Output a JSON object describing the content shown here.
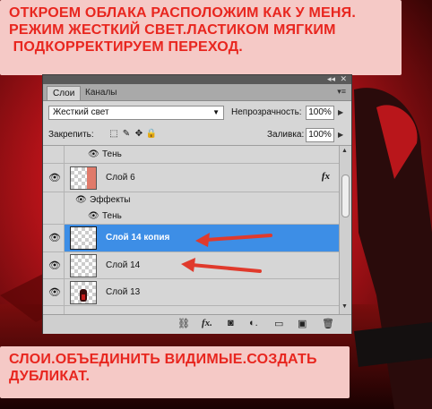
{
  "instructions": {
    "top_lines": [
      "ОТКРОЕМ ОБЛАКА РАСПОЛОЖИМ КАК У МЕНЯ.",
      "РЕЖИМ ЖЕСТКИЙ СВЕТ.ЛАСТИКОМ МЯГКИМ",
      " ПОДКОРРЕКТИРУЕМ ПЕРЕХОД."
    ],
    "bottom_lines": [
      "СЛОИ.ОБЪЕДИНИТЬ ВИДИМЫЕ.СОЗДАТЬ",
      "ДУБЛИКАТ."
    ],
    "text_color": "#e8261f",
    "box_color": "#f5c9c6"
  },
  "panel": {
    "tabs": {
      "layers": "Слои",
      "channels": "Каналы"
    },
    "blend_mode": "Жесткий свет",
    "opacity_label": "Непрозрачность:",
    "opacity_value": "100%",
    "lock_label": "Закрепить:",
    "fill_label": "Заливка:",
    "fill_value": "100%",
    "layers": {
      "shadow_top": "Тень",
      "layer6": "Слой 6",
      "effects": "Эффекты",
      "shadow": "Тень",
      "layer14copy": "Слой 14 копия",
      "layer14": "Слой 14",
      "layer13": "Слой 13"
    },
    "fx_symbol": "fx",
    "selection_color": "#3d8ee6"
  },
  "icons": {
    "eye": "eye-icon",
    "arrow_annotation_color": "#e03a2c"
  }
}
